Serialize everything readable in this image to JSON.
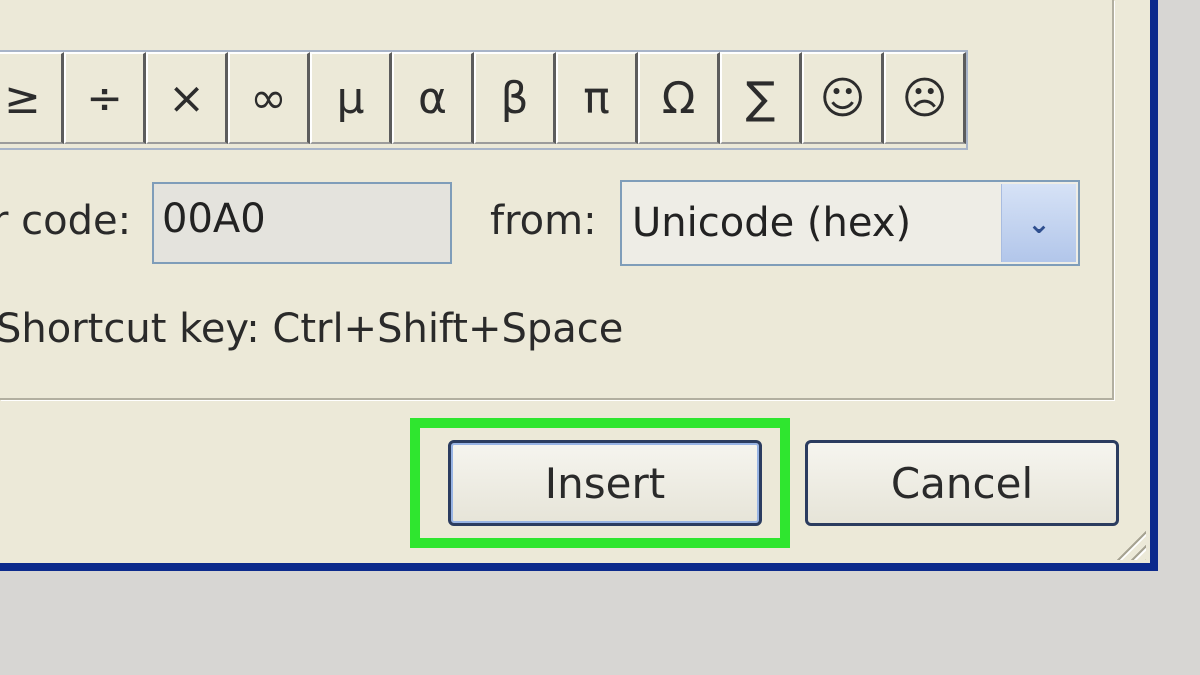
{
  "symbols": [
    "≥",
    "÷",
    "×",
    "∞",
    "µ",
    "α",
    "β",
    "π",
    "Ω",
    "∑",
    "☺",
    "☹"
  ],
  "character_code": {
    "label": "r code:",
    "value": "00A0"
  },
  "from": {
    "label": "from:",
    "selected": "Unicode (hex)"
  },
  "shortcut": {
    "text": "Shortcut key: Ctrl+Shift+Space"
  },
  "buttons": {
    "insert": "Insert",
    "cancel": "Cancel"
  },
  "colors": {
    "highlight": "#2fe62f",
    "window_border": "#0c2a8c"
  }
}
